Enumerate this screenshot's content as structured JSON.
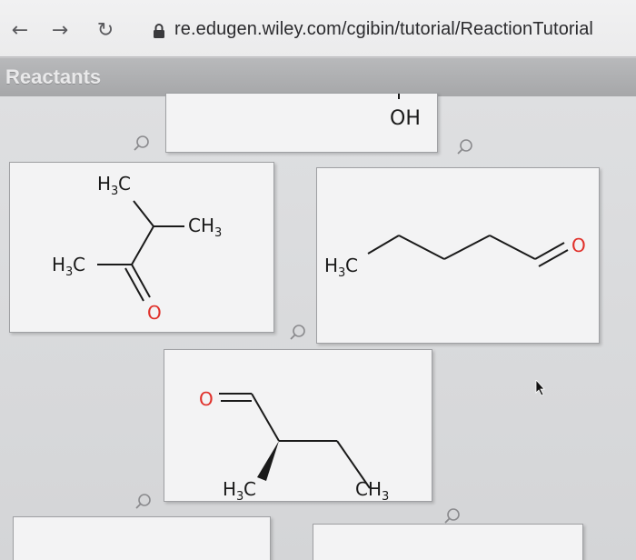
{
  "browser": {
    "back_icon": "arrow-left-icon",
    "forward_icon": "arrow-right-icon",
    "reload_icon": "reload-icon",
    "lock_icon": "lock-icon",
    "url": "re.edugen.wiley.com/cgibin/tutorial/ReactionTutorial"
  },
  "section": {
    "title": "Reactants"
  },
  "molecules": {
    "top_partial": {
      "label": "OH"
    },
    "ketone": {
      "methyl_top": "H",
      "methyl_top_sub": "3",
      "methyl_top_c": "C",
      "branch_methyl": "CH",
      "branch_methyl_sub": "3",
      "methyl_left": "H",
      "methyl_left_sub": "3",
      "methyl_left_c": "C",
      "oxygen": "O"
    },
    "aldehyde_chain": {
      "methyl": "H",
      "methyl_sub": "3",
      "methyl_c": "C",
      "oxygen": "O"
    },
    "chiral_aldehyde": {
      "oxygen": "O",
      "methyl_wedge": "H",
      "methyl_wedge_sub": "3",
      "methyl_wedge_c": "C",
      "methyl_end": "CH",
      "methyl_end_sub": "3"
    }
  },
  "icons": {
    "zoom": "magnifier-icon",
    "pointer": "mouse-cursor-icon"
  },
  "colors": {
    "oxygen": "#e0302a",
    "header_bar": "#a6a7a9"
  }
}
